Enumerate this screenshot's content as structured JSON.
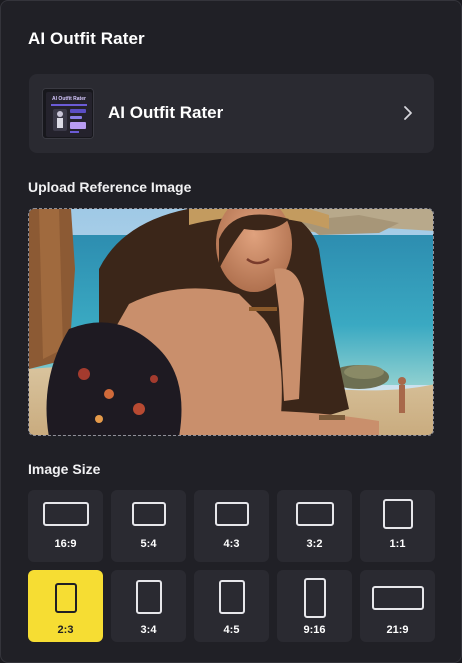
{
  "panel": {
    "title": "AI Outfit Rater"
  },
  "tool_card": {
    "name": "AI Outfit Rater",
    "thumb_caption": "AI Outfit Rater",
    "icon": "chevron-right-icon"
  },
  "upload": {
    "label": "Upload Reference Image"
  },
  "image_size": {
    "label": "Image Size",
    "selected": "2:3",
    "accent_color": "#f6dd33",
    "options": [
      {
        "ratio": "16:9"
      },
      {
        "ratio": "5:4"
      },
      {
        "ratio": "4:3"
      },
      {
        "ratio": "3:2"
      },
      {
        "ratio": "1:1"
      },
      {
        "ratio": "2:3"
      },
      {
        "ratio": "3:4"
      },
      {
        "ratio": "4:5"
      },
      {
        "ratio": "9:16"
      },
      {
        "ratio": "21:9"
      }
    ]
  }
}
